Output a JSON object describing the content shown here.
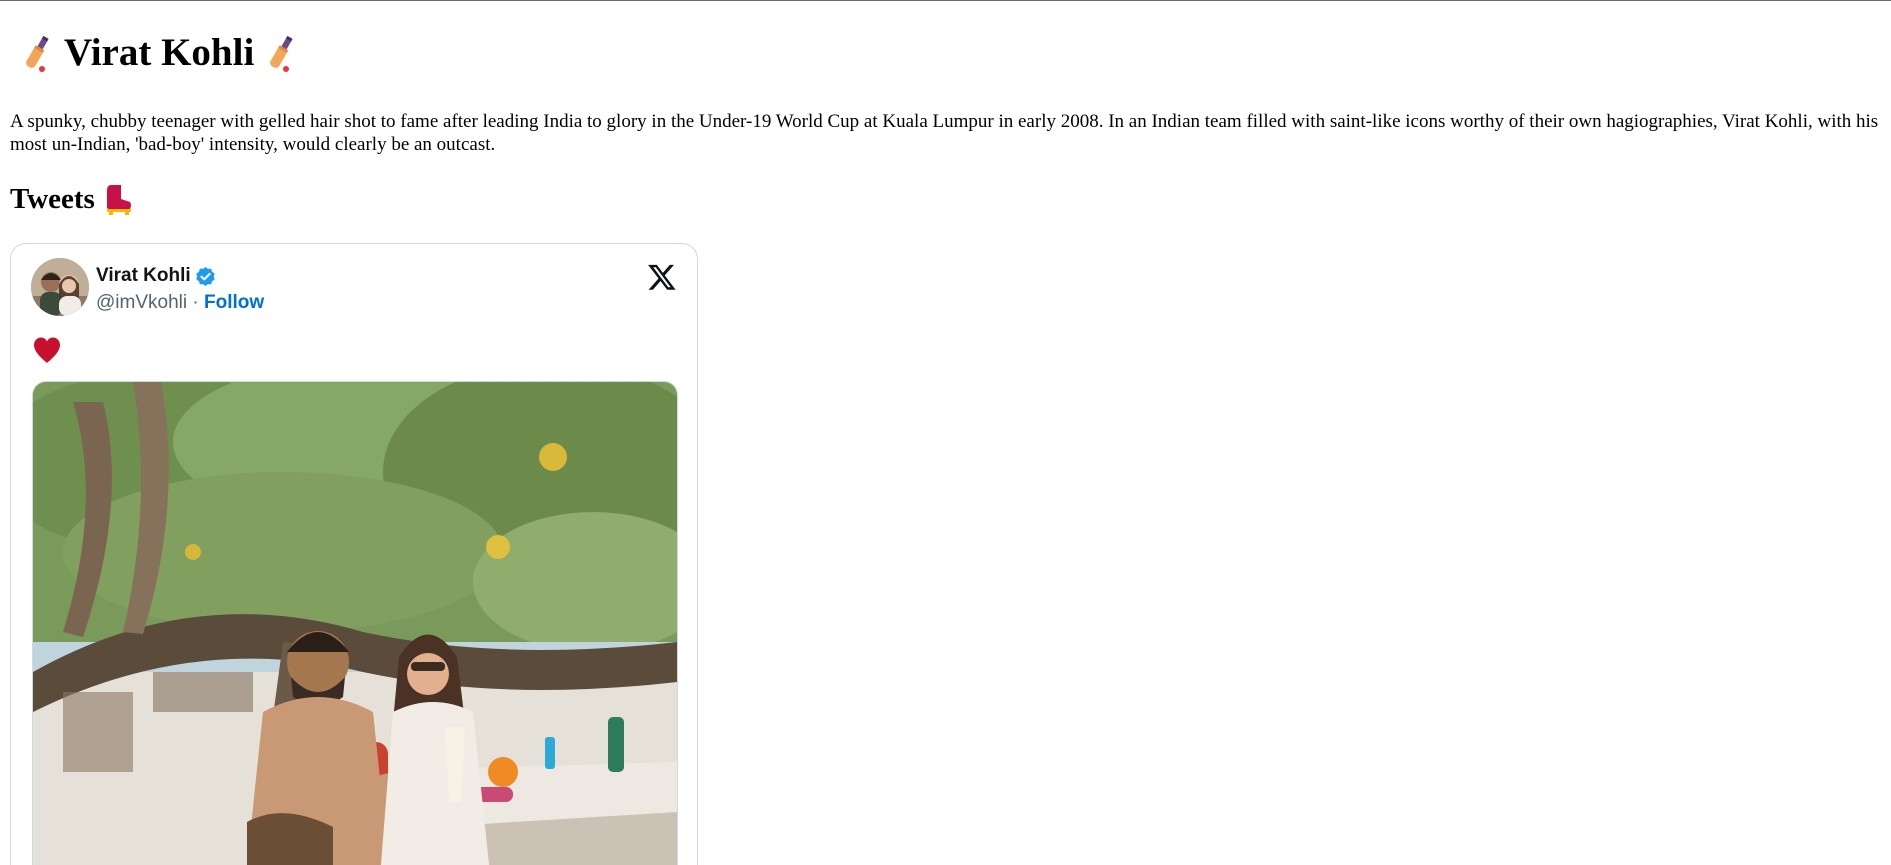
{
  "page": {
    "title": "Virat Kohli",
    "title_icon_left": "cricket-bat-icon",
    "title_icon_right": "cricket-bat-icon",
    "intro": "A spunky, chubby teenager with gelled hair shot to fame after leading India to glory in the Under-19 World Cup at Kuala Lumpur in early 2008. In an Indian team filled with saint-like icons worthy of their own hagiographies, Virat Kohli, with his most un-Indian, 'bad-boy' intensity, would clearly be an outcast.",
    "section_title": "Tweets",
    "section_icon": "boot-icon"
  },
  "tweet": {
    "author_name": "Virat Kohli",
    "handle": "@imVkohli",
    "separator": "·",
    "follow_label": "Follow",
    "verified_icon": "verified-badge-icon",
    "platform_icon": "x-logo-icon",
    "text_icon": "red-heart-icon",
    "colors": {
      "follow": "#006fd6",
      "verified": "#1d9bf0",
      "heart": "#c8102e"
    }
  }
}
